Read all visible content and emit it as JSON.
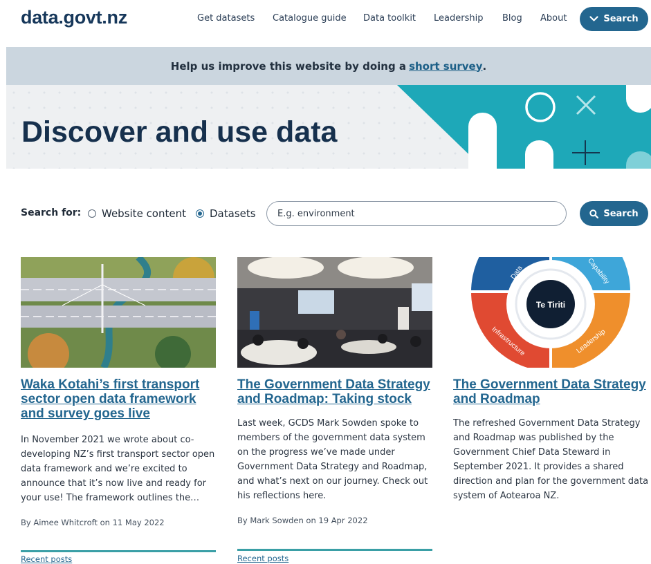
{
  "header": {
    "logo": "data.govt.nz",
    "nav": [
      "Get datasets",
      "Catalogue guide",
      "Data toolkit",
      "Leadership",
      "Blog",
      "About"
    ],
    "search_button": "Search"
  },
  "survey": {
    "text": "Help us improve this website by doing a",
    "link": "short survey",
    "end": "."
  },
  "hero": {
    "title": "Discover and use data"
  },
  "search": {
    "label": "Search for:",
    "option_website": "Website content",
    "option_datasets": "Datasets",
    "selected": "Datasets",
    "placeholder": "E.g. environment",
    "button": "Search"
  },
  "cards": [
    {
      "title": "Waka Kotahi’s first transport sector open data framework and survey goes live",
      "body": "In November 2021 we wrote about co-developing NZ’s first transport sector open data framework and we’re excited to announce that it’s now live and ready for your use! The framework outlines the…",
      "meta": "By Aimee Whitcroft on 11 May 2022",
      "recent": "Recent posts"
    },
    {
      "title": "The Government Data Strategy and Roadmap: Taking stock",
      "body": "Last week, GCDS Mark Sowden spoke to members of the government data system on the progress we’ve made under Government Data Strategy and Roadmap, and what’s next on our journey. Check out his reflections here.",
      "meta": "By Mark Sowden on 19 Apr 2022",
      "recent": "Recent posts"
    },
    {
      "title": "The Government Data Strategy and Roadmap",
      "body": "The refreshed Government Data Strategy and Roadmap was published by the Government Chief Data Steward in September 2021. It provides a shared direction and plan for the government data system of Aotearoa NZ.",
      "diagram_center": "Te Tiriti",
      "diagram_labels": [
        "Data",
        "Capability",
        "Infrastructure",
        "Leadership"
      ]
    }
  ],
  "colors": {
    "brand": "#16375a",
    "accent": "#23668f",
    "teal": "#1ea8b8",
    "banner": "#cbd6df"
  }
}
